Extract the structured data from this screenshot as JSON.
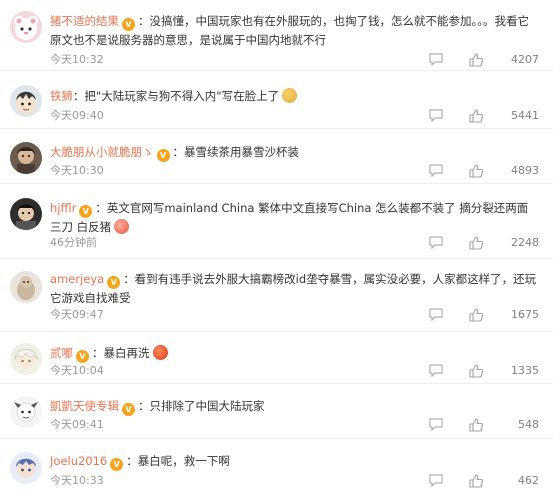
{
  "comments": [
    {
      "username": "猪不适的结果",
      "text": "：没搞懂，中国玩家也有在外服玩的，也掏了钱，怎么就不能参加。。。我看它原文也不是说服务器的意思，是说属于中国内地就不行",
      "time": "今天10:32",
      "likes": "4207",
      "vip": "V"
    },
    {
      "username": "铁狮",
      "text": "：把\"大陆玩家与狗不得入内\"写在脸上了",
      "time": "今天09:40",
      "likes": "5441",
      "emoji": "doge-icon"
    },
    {
      "username": "大脆朋从小就脆朋ゝ",
      "text": "：暴雪续茶用暴雪沙杯装",
      "time": "今天10:30",
      "likes": "4893",
      "vip": "V"
    },
    {
      "username": "hjfflr",
      "text": "：英文官网写mainland China 繁体中文直接写China 怎么装都不装了 摘分裂还两面三刀 白反猪",
      "time": "46分钟前",
      "likes": "2248",
      "vip": "V",
      "emoji": "angry-face-icon"
    },
    {
      "username": "amerjeya",
      "text": "：看到有违手说去外服大搞霸榜改id垄夺暴雪，属实没必要，人家都这样了，还玩它游戏自找难受",
      "time": "今天09:47",
      "likes": "1675",
      "vip": "V"
    },
    {
      "username": "贰嘟",
      "text": "：暴白再洗",
      "time": "今天10:04",
      "likes": "1335",
      "vip": "V",
      "emoji": "angry-red-face-icon"
    },
    {
      "username": "凱凱天使专辑",
      "text": "：只排除了中国大陆玩家",
      "time": "今天09:41",
      "likes": "548",
      "vip": "V"
    },
    {
      "username": "Joelu2016",
      "text": "：暴白呢，救一下啊",
      "time": "今天10:33",
      "likes": "462",
      "vip": "V"
    }
  ],
  "colors": {
    "username": "#eb7350",
    "text": "#333333",
    "meta": "#999999",
    "vip": "#f7a41c"
  }
}
